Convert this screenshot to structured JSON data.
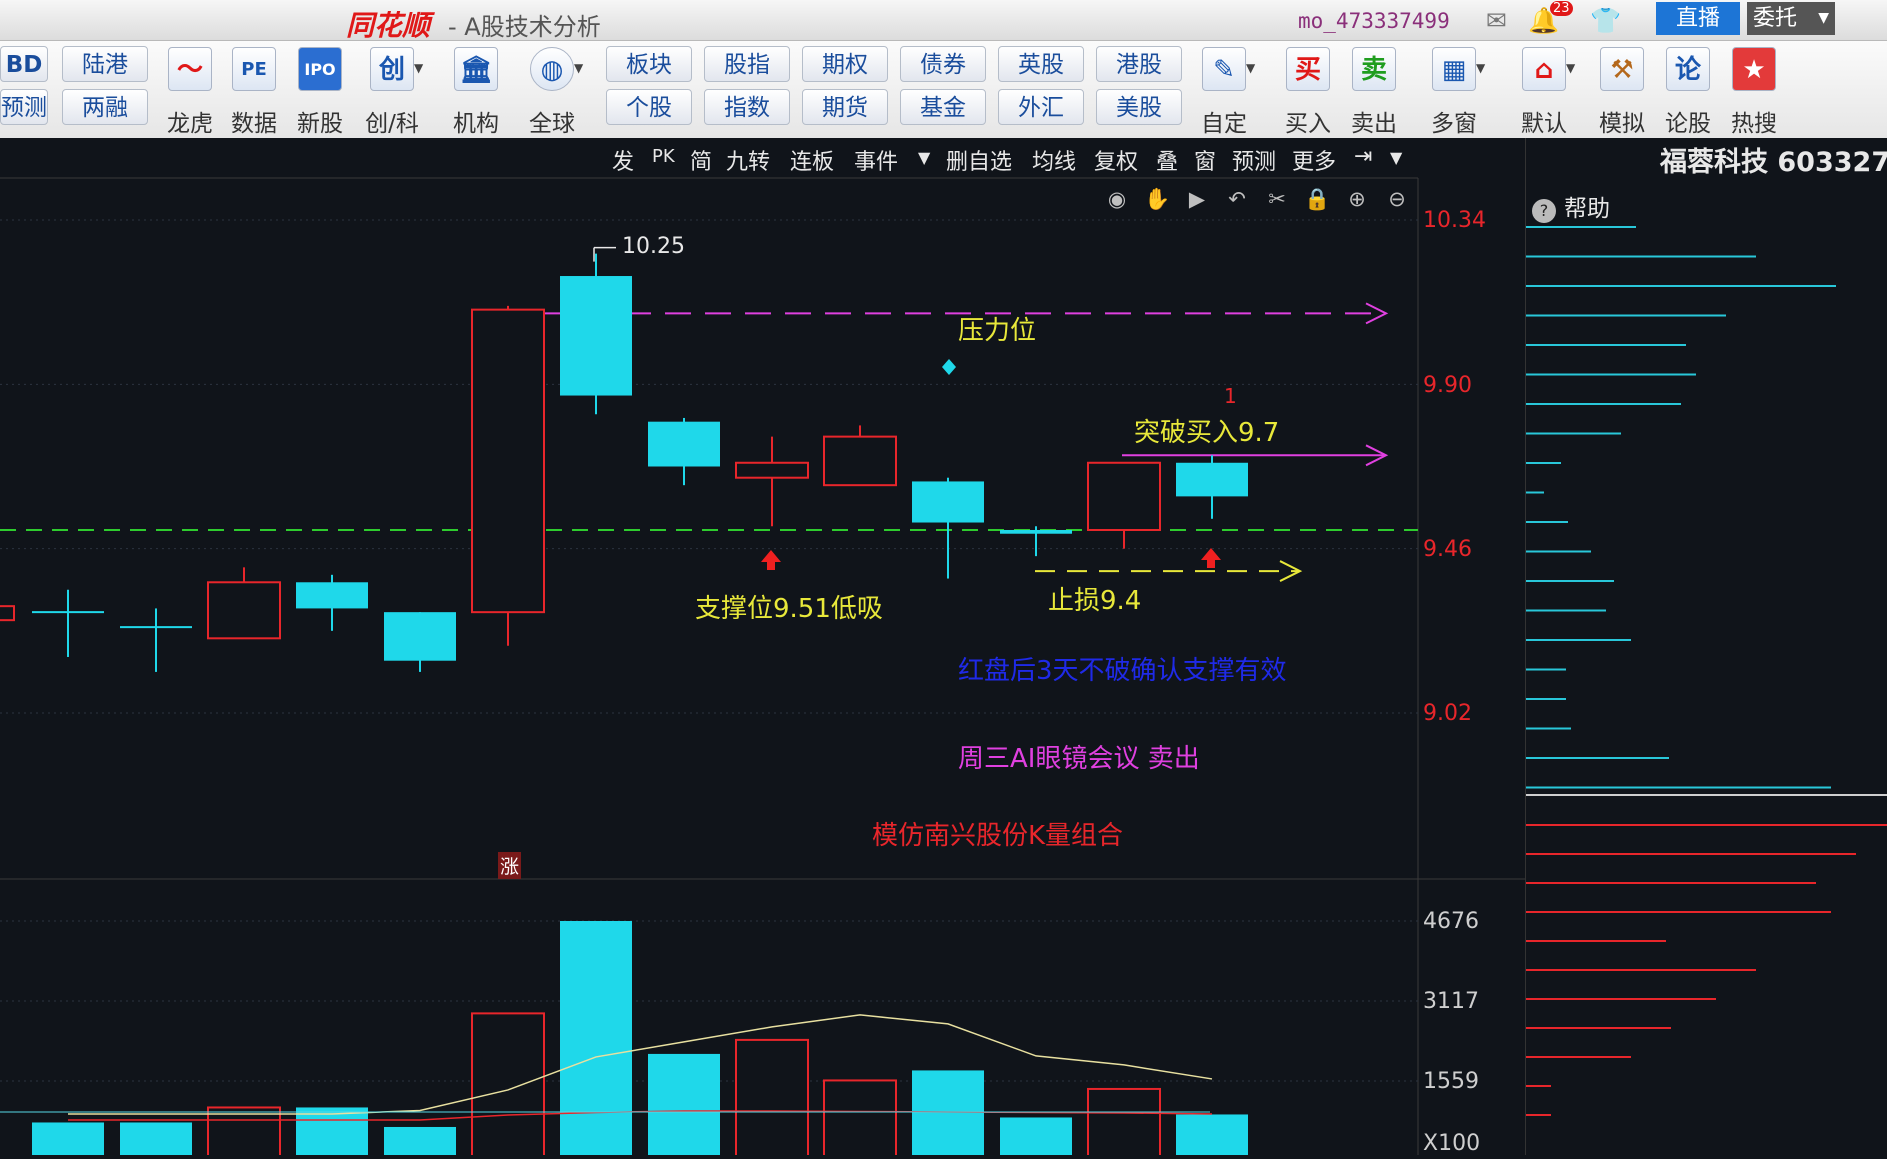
{
  "titlebar": {
    "app_name": "同花顺",
    "window_subtitle": "- A股技术分析",
    "user_id": "mo_473337499",
    "notify_count": "23",
    "live_label": "直播",
    "entrust_label": "委托"
  },
  "toolbar": {
    "left_top": "BD",
    "left_bottom": "预测",
    "text_buttons_top": [
      "陆港",
      "板块",
      "股指",
      "期权",
      "债券",
      "英股",
      "港股"
    ],
    "text_buttons_bottom": [
      "两融",
      "个股",
      "指数",
      "期货",
      "基金",
      "外汇",
      "美股"
    ],
    "icon_buttons": [
      {
        "label": "龙虎",
        "icon": "dragon-tiger-icon"
      },
      {
        "label": "数据",
        "icon": "pe-data-icon"
      },
      {
        "label": "新股",
        "icon": "ipo-icon"
      },
      {
        "label": "创/科",
        "icon": "chuang-icon"
      },
      {
        "label": "机构",
        "icon": "institution-icon"
      },
      {
        "label": "全球",
        "icon": "globe-icon"
      },
      {
        "label": "自定",
        "icon": "custom-icon"
      },
      {
        "label": "买入",
        "icon": "buy-icon"
      },
      {
        "label": "卖出",
        "icon": "sell-icon"
      },
      {
        "label": "多窗",
        "icon": "multi-window-icon"
      },
      {
        "label": "默认",
        "icon": "home-icon"
      },
      {
        "label": "模拟",
        "icon": "hammer-icon"
      },
      {
        "label": "论股",
        "icon": "forum-icon"
      },
      {
        "label": "热搜",
        "icon": "hot-search-icon"
      }
    ]
  },
  "chart_toolbar": {
    "items": [
      "发",
      "PK",
      "简",
      "九转",
      "连板",
      "事件",
      "删自选",
      "均线",
      "复权",
      "叠",
      "窗",
      "预测",
      "更多"
    ]
  },
  "stock": {
    "name_code": "福蓉科技 603327"
  },
  "panel": {
    "help_label": "帮助"
  },
  "annotations": {
    "pressure": "压力位",
    "breakout_buy": "突破买入9.7",
    "breakout_marker": "1",
    "support": "支撑位9.51低吸",
    "stop_loss": "止损9.4",
    "confirm_support": "红盘后3天不破确认支撑有效",
    "wednesday_sell": "周三AI眼镜会议 卖出",
    "imitate": "模仿南兴股份K量组合",
    "limit_up_mark": "涨",
    "high_label": "10.25"
  },
  "colors": {
    "up": "#e8262b",
    "down": "#1fd8ea",
    "pressure_line": "#e040e0",
    "support_line": "#2ecc2e",
    "stop_line": "#e8e83a",
    "confirm_text": "#1f2ae8",
    "sell_text": "#e040e0",
    "imitate_text": "#e8262b",
    "annot_text": "#e8e83a"
  },
  "chart_data": [
    {
      "type": "candlestick",
      "y_ticks": [
        "10.34",
        "9.90",
        "9.46",
        "9.02"
      ],
      "ylim": [
        8.76,
        10.53
      ],
      "candles": [
        {
          "o": 9.29,
          "c": 9.29,
          "h": 9.35,
          "l": 9.17
        },
        {
          "o": 9.25,
          "c": 9.25,
          "h": 9.3,
          "l": 9.13
        },
        {
          "o": 9.22,
          "c": 9.37,
          "h": 9.41,
          "l": 9.22
        },
        {
          "o": 9.37,
          "c": 9.3,
          "h": 9.39,
          "l": 9.24
        },
        {
          "o": 9.29,
          "c": 9.16,
          "h": 9.29,
          "l": 9.13
        },
        {
          "o": 9.29,
          "c": 10.1,
          "h": 10.11,
          "l": 9.2
        },
        {
          "o": 10.19,
          "c": 9.87,
          "h": 10.25,
          "l": 9.82
        },
        {
          "o": 9.8,
          "c": 9.68,
          "h": 9.81,
          "l": 9.63
        },
        {
          "o": 9.65,
          "c": 9.69,
          "h": 9.76,
          "l": 9.52
        },
        {
          "o": 9.63,
          "c": 9.76,
          "h": 9.79,
          "l": 9.63
        },
        {
          "o": 9.64,
          "c": 9.53,
          "h": 9.65,
          "l": 9.38
        },
        {
          "o": 9.51,
          "c": 9.5,
          "h": 9.52,
          "l": 9.44
        },
        {
          "o": 9.51,
          "c": 9.69,
          "h": 9.69,
          "l": 9.46
        },
        {
          "o": 9.69,
          "c": 9.6,
          "h": 9.71,
          "l": 9.54
        }
      ],
      "lines": {
        "pressure": 10.09,
        "breakout": 9.71,
        "support": 9.51,
        "stop": 9.4
      }
    },
    {
      "type": "bar",
      "ylabel": "X100",
      "y_ticks": [
        "4676",
        "3117",
        "1559"
      ],
      "ylim": [
        0,
        4676
      ],
      "values": [
        650,
        650,
        950,
        950,
        560,
        2830,
        4676,
        2020,
        2300,
        1490,
        1690,
        750,
        1320,
        810
      ],
      "ma_slow": [
        820,
        820,
        820,
        820,
        890,
        1300,
        1960,
        2260,
        2560,
        2800,
        2620,
        1980,
        1800,
        1520
      ],
      "ma_fast": [
        700,
        700,
        700,
        700,
        700,
        800,
        850,
        880,
        880,
        870,
        860,
        850,
        840,
        820
      ]
    }
  ]
}
